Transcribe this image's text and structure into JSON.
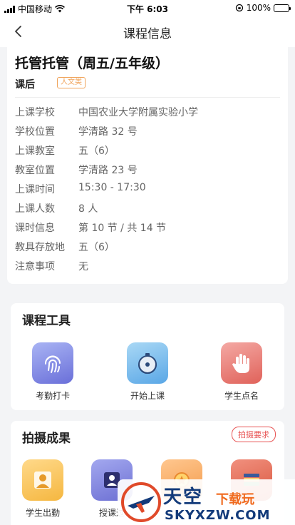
{
  "status_bar": {
    "carrier": "中国移动",
    "time": "下午 6:03",
    "battery": "100%"
  },
  "nav": {
    "title": "课程信息"
  },
  "course": {
    "title": "托管托管（周五/五年级）",
    "type": "课后",
    "tag": "人文类",
    "rows": [
      {
        "label": "上课学校",
        "value": "中国农业大学附属实验小学"
      },
      {
        "label": "学校位置",
        "value": "学清路 32 号"
      },
      {
        "label": "上课教室",
        "value": "五（6）"
      },
      {
        "label": "教室位置",
        "value": "学清路 23 号"
      },
      {
        "label": "上课时间",
        "value": "15:30 - 17:30"
      },
      {
        "label": "上课人数",
        "value": "8 人"
      },
      {
        "label": "课时信息",
        "value": "第 10 节 / 共 14 节"
      },
      {
        "label": "教具存放地",
        "value": "五（6）"
      },
      {
        "label": "注意事项",
        "value": "无"
      }
    ]
  },
  "tools": {
    "title": "课程工具",
    "items": [
      {
        "label": "考勤打卡",
        "icon": "fingerprint-icon"
      },
      {
        "label": "开始上课",
        "icon": "bell-icon"
      },
      {
        "label": "学生点名",
        "icon": "raised-hand-icon"
      }
    ]
  },
  "photos": {
    "title": "拍摄成果",
    "requirement": "拍摄要求",
    "items": [
      {
        "label": "学生出勤",
        "icon": "student-icon"
      },
      {
        "label": "授课过",
        "icon": "teacher-icon"
      },
      {
        "label": "",
        "icon": "medal-icon"
      },
      {
        "label": "",
        "icon": "books-icon"
      }
    ]
  },
  "watermark": {
    "title": "天空",
    "sub": "下载玩",
    "url": "SKYXZW.COM"
  },
  "colors": {
    "accent": "#f0a35a",
    "danger": "#e85555",
    "brand_blue": "#123a7a"
  }
}
